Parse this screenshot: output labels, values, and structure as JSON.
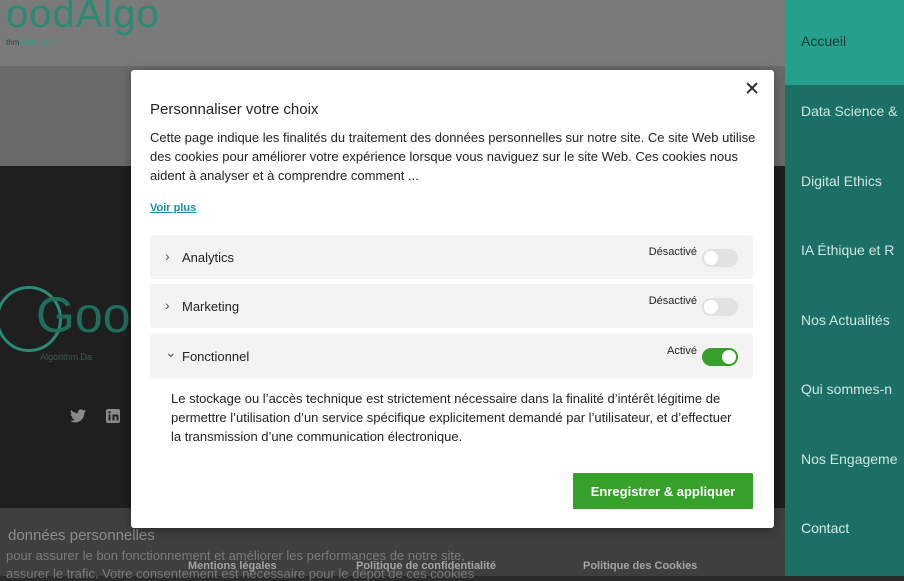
{
  "background": {
    "logo_text": "oodAlgo",
    "logo_subtitle_prefix": "thm ",
    "logo_subtitle_accent": "Data Ethic",
    "footer_logo_text": "Goo",
    "footer_logo_subtitle": "Algorithm Da",
    "cookie_banner_title": "données personnelles",
    "cookie_banner_line1": "pour assurer le bon fonctionnement et améliorer les performances de notre site,",
    "cookie_banner_line2": "assurer le trafic. Votre consentement est nécessaire pour le dépôt de ces cookies",
    "footer_links": [
      "Mentions légales",
      "Politique de confidentialité",
      "Politique des Cookies"
    ]
  },
  "nav": {
    "items": [
      {
        "label": "Accueil",
        "active": true
      },
      {
        "label": "Data Science & "
      },
      {
        "label": "Digital Ethics"
      },
      {
        "label": "IA Éthique et R"
      },
      {
        "label": "Nos Actualités"
      },
      {
        "label": "Qui sommes-n"
      },
      {
        "label": "Nos Engageme"
      },
      {
        "label": "Contact"
      }
    ]
  },
  "modal": {
    "close_symbol": "✕",
    "title": "Personnaliser votre choix",
    "description": "Cette page indique les finalités du traitement des données personnelles sur notre site. Ce site Web utilise des cookies pour améliorer votre expérience lorsque vous naviguez sur le site Web. Ces cookies nous aident à analyser et à comprendre comment ...",
    "read_more": "Voir plus",
    "categories": [
      {
        "chevron": "›",
        "name": "Analytics",
        "status": "Désactivé",
        "enabled": false
      },
      {
        "chevron": "›",
        "name": "Marketing",
        "status": "Désactivé",
        "enabled": false
      },
      {
        "chevron": "⌄",
        "name": "Fonctionnel",
        "status": "Activé",
        "enabled": true
      }
    ],
    "functional_detail": "Le stockage ou l’accès technique est strictement nécessaire dans la finalité d’intérêt légitime de permettre l’utilisation d’un service spécifique explicitement demandé par l’utilisateur, et d’effectuer la transmission d’une communication électronique.",
    "save_button": "Enregistrer & appliquer"
  },
  "colors": {
    "accent_green": "#37a02b",
    "nav_teal": "#1c6f64",
    "nav_active": "#25a08c",
    "link_blue": "#1a8fa8"
  }
}
